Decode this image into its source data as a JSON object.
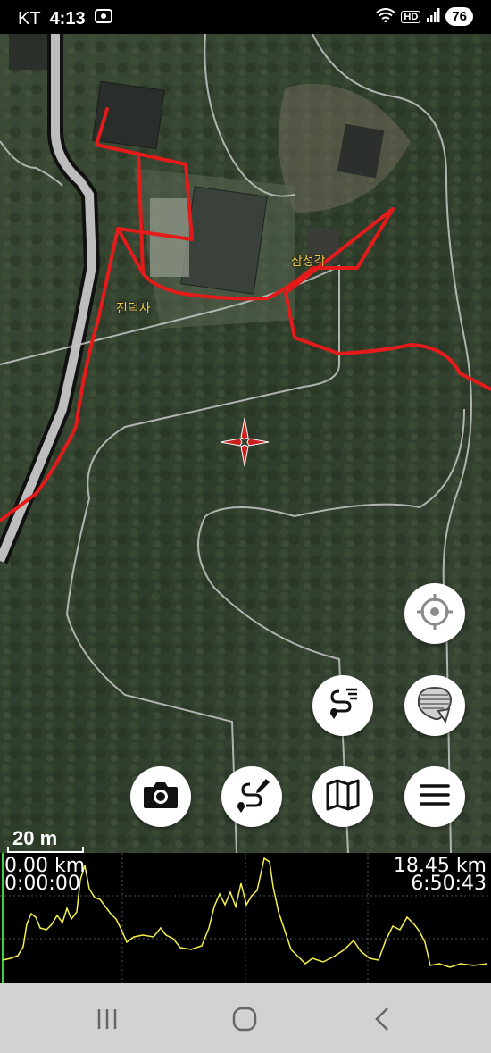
{
  "status": {
    "carrier": "KT",
    "time": "4:13",
    "battery": "76",
    "hd": "HD"
  },
  "map": {
    "places": [
      {
        "name": "진덕사"
      },
      {
        "name": "삼성각"
      }
    ],
    "scale": "20 m"
  },
  "buttons": {
    "locate": "crosshair-locate-icon",
    "layers": "map-layers-icon",
    "route_list": "route-list-icon",
    "camera": "camera-icon",
    "route_edit": "route-edit-icon",
    "map": "map-icon",
    "menu": "menu-icon"
  },
  "elevation": {
    "start_distance": "0.00 km",
    "start_time": "0:00:00",
    "total_distance": "18.45 km",
    "total_time": "6:50:43",
    "line_color": "#f5f04a"
  },
  "colors": {
    "track": "#e31b1b",
    "trail": "#c8c8c8",
    "accent": "#cc1f1f"
  }
}
